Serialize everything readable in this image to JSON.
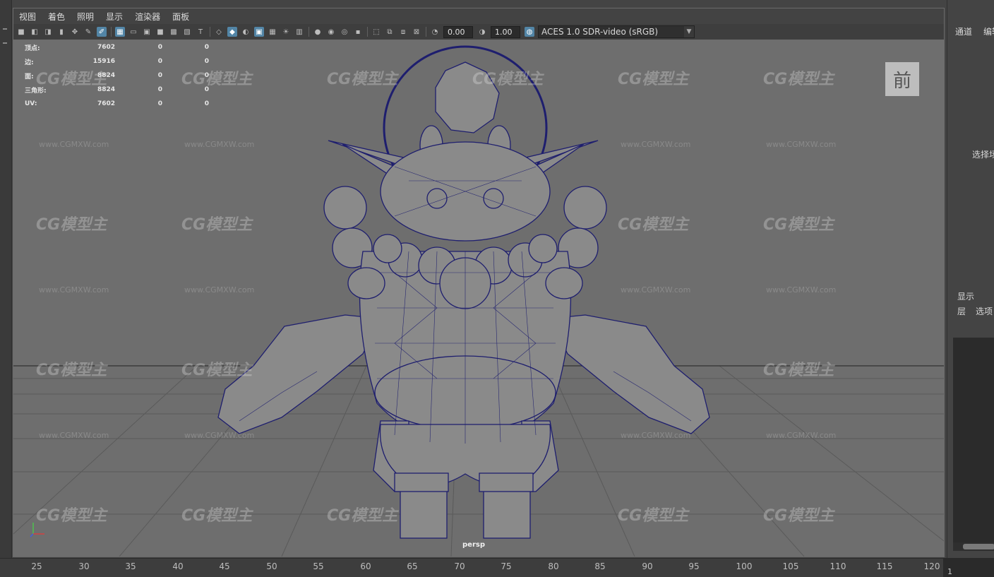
{
  "menu": [
    "视图",
    "着色",
    "照明",
    "显示",
    "渲染器",
    "面板"
  ],
  "toolbar": {
    "exposure_value": "0.00",
    "gamma_value": "1.00",
    "color_space": "ACES 1.0 SDR-video (sRGB)"
  },
  "hud": {
    "rows": [
      {
        "label": "顶点:",
        "v1": "7602",
        "v2": "0",
        "v3": "0"
      },
      {
        "label": "边:",
        "v1": "15916",
        "v2": "0",
        "v3": "0"
      },
      {
        "label": "面:",
        "v1": "8824",
        "v2": "0",
        "v3": "0"
      },
      {
        "label": "三角形:",
        "v1": "8824",
        "v2": "0",
        "v3": "0"
      },
      {
        "label": "UV:",
        "v1": "7602",
        "v2": "0",
        "v3": "0"
      }
    ]
  },
  "view_cube_label": "前",
  "camera_label": "persp",
  "watermark": {
    "text": "CG模型主",
    "url": "www.CGMXW.com"
  },
  "right_panel": {
    "channels_tab": "通道",
    "edit_tab": "编辑",
    "select_hint": "选择场",
    "display_tab": "显示",
    "layers_menu": "层",
    "options_menu": "选项"
  },
  "timeline": {
    "labels": [
      "25",
      "30",
      "35",
      "40",
      "45",
      "50",
      "55",
      "60",
      "65",
      "70",
      "75",
      "80",
      "85",
      "90",
      "95",
      "100",
      "105",
      "110",
      "115",
      "120"
    ],
    "current_frame": "1"
  },
  "colors": {
    "viewport_bg": "#6e6e6e",
    "wireframe": "#1e1e6e",
    "mesh_fill": "#8a8a8a",
    "active_icon": "#5285a6"
  }
}
